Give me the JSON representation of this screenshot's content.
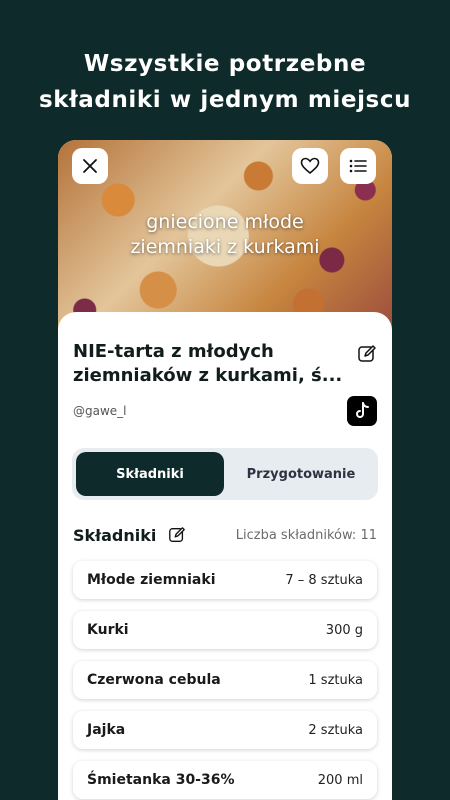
{
  "headline": {
    "line1": "Wszystkie potrzebne",
    "line2": "składniki w jednym miejscu"
  },
  "hero": {
    "caption_line1": "gniecione młode",
    "caption_line2": "ziemniaki z kurkami"
  },
  "recipe": {
    "title_line1": "NIE-tarta z młodych",
    "title_line2": "ziemniaków z kurkami, ś...",
    "author": "@gawe_l"
  },
  "tabs": [
    {
      "label": "Składniki",
      "active": true
    },
    {
      "label": "Przygotowanie",
      "active": false
    }
  ],
  "ingredients": {
    "header": "Składniki",
    "count_label": "Liczba składników: 11",
    "items": [
      {
        "name": "Młode ziemniaki",
        "qty": "7 – 8 sztuka"
      },
      {
        "name": "Kurki",
        "qty": "300 g"
      },
      {
        "name": "Czerwona cebula",
        "qty": "1 sztuka"
      },
      {
        "name": "Jajka",
        "qty": "2 sztuka"
      },
      {
        "name": "Śmietanka 30-36%",
        "qty": "200 ml"
      }
    ]
  },
  "colors": {
    "background": "#0f2a2a",
    "accent": "#0f2a2a",
    "tabs_bg": "#e7ecf1"
  },
  "icons": [
    "close-icon",
    "heart-icon",
    "list-icon",
    "edit-icon",
    "tiktok-icon"
  ]
}
